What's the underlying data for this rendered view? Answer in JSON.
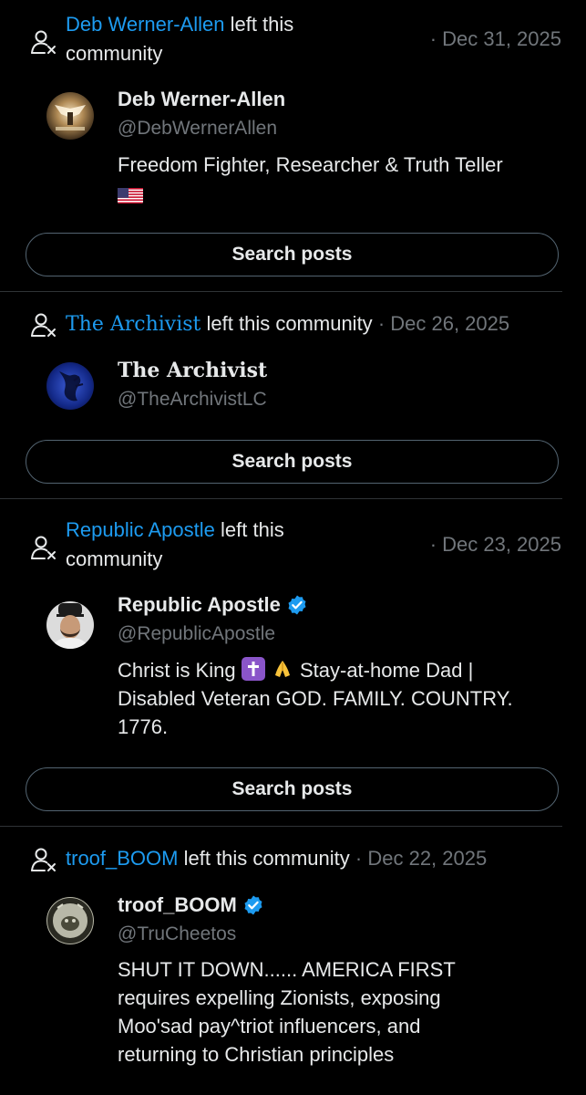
{
  "colors": {
    "background": "#000000",
    "text": "#e7e9ea",
    "secondary": "#71767b",
    "link": "#1d9bf0",
    "divider": "#2f3336",
    "verified": "#1d9bf0"
  },
  "entries": [
    {
      "actor": "Deb Werner-Allen",
      "action": "left this community",
      "date": "· Dec 31, 2025",
      "name": "Deb Werner-Allen",
      "handle": "@DebWernerAllen",
      "verified": false,
      "bio": "Freedom Fighter, Researcher & Truth Teller",
      "bio_emoji": "us-flag",
      "button": "Search posts"
    },
    {
      "actor": "The Archivist",
      "action": "left this community",
      "date": "· Dec 26, 2025",
      "name": "The Archivist",
      "handle": "@TheArchivistLC",
      "verified": false,
      "button": "Search posts"
    },
    {
      "actor": "Republic Apostle",
      "action": "left this community",
      "date": "· Dec 23, 2025",
      "name": "Republic Apostle",
      "handle": "@RepublicApostle",
      "verified": true,
      "bio_before": "Christ is King",
      "bio_after": "Stay-at-home Dad | Disabled Veteran GOD. FAMILY. COUNTRY. 1776.",
      "bio_emoji": [
        "latin-cross",
        "folded-hands"
      ],
      "button": "Search posts"
    },
    {
      "actor": "troof_BOOM",
      "action": "left this community",
      "date": "· Dec 22, 2025",
      "name": "troof_BOOM",
      "handle": "@TruCheetos",
      "verified": true,
      "bio": "SHUT IT DOWN...... AMERICA FIRST requires expelling Zionists, exposing Moo'sad pay^triot influencers, and returning to Christian principles"
    }
  ],
  "icons": {
    "leave": "person-remove-icon",
    "verified": "verified-badge-icon"
  }
}
